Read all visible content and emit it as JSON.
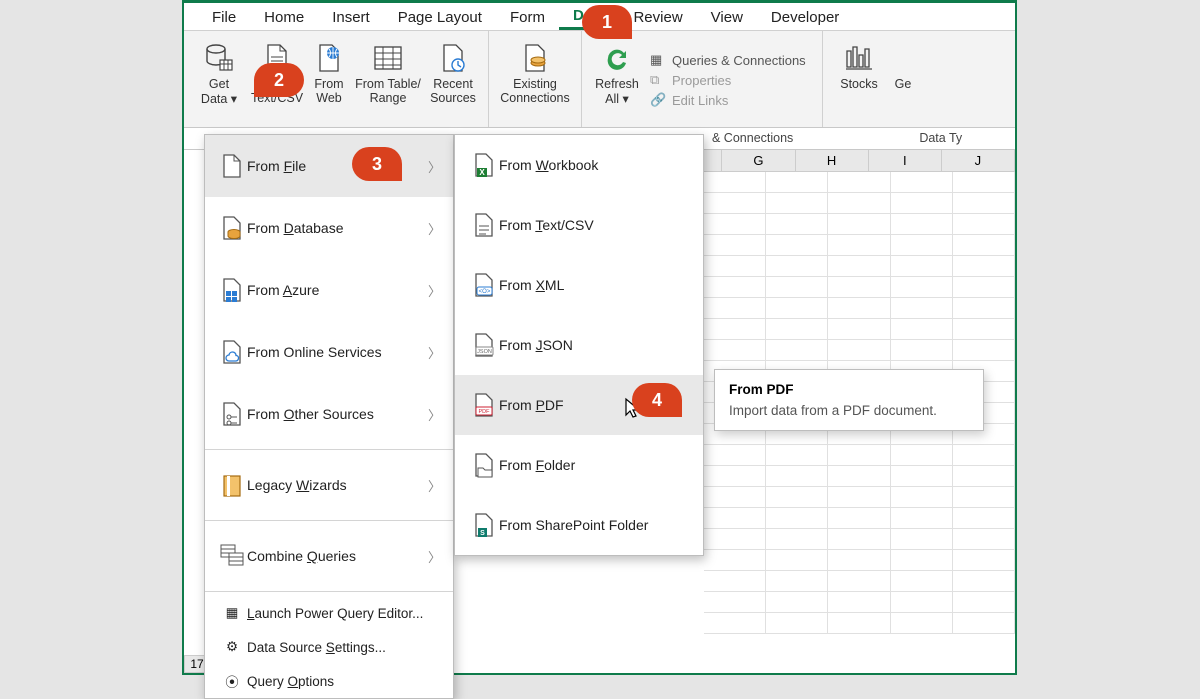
{
  "tabs": [
    "File",
    "Home",
    "Insert",
    "Page Layout",
    "Form",
    "Data",
    "Review",
    "View",
    "Developer"
  ],
  "active_tab": "Data",
  "ribbon": {
    "get_data": {
      "l1": "Get",
      "l2": "Data ▾"
    },
    "text_csv": {
      "l1": "From",
      "l2": "Text/CSV"
    },
    "web": {
      "l1": "From",
      "l2": "Web"
    },
    "table": {
      "l1": "From Table/",
      "l2": "Range"
    },
    "recent": {
      "l1": "Recent",
      "l2": "Sources"
    },
    "existing": {
      "l1": "Existing",
      "l2": "Connections"
    },
    "refresh": {
      "l1": "Refresh",
      "l2": "All ▾"
    },
    "queries": "Queries & Connections",
    "properties": "Properties",
    "editlinks": "Edit Links",
    "stocks": "Stocks",
    "geo": "Ge"
  },
  "section_labels": {
    "qc": "& Connections",
    "dt": "Data Ty"
  },
  "menu1": [
    {
      "label": "From File",
      "sub": true,
      "hover": true,
      "u": "F"
    },
    {
      "label": "From Database",
      "sub": true,
      "u": "D"
    },
    {
      "label": "From Azure",
      "sub": true,
      "u": "A"
    },
    {
      "label": "From Online Services",
      "sub": true
    },
    {
      "label": "From Other Sources",
      "sub": true,
      "u": "O"
    },
    {
      "label": "Legacy Wizards",
      "sub": true,
      "u": "W"
    },
    {
      "label": "Combine Queries",
      "sub": true,
      "u": "Q"
    }
  ],
  "menu1_bottom": [
    {
      "label": "Launch Power Query Editor...",
      "u": "L"
    },
    {
      "label": "Data Source Settings...",
      "u": "S"
    },
    {
      "label": "Query Options",
      "u": "O"
    }
  ],
  "menu2": [
    {
      "label": "From Workbook",
      "u": "W"
    },
    {
      "label": "From Text/CSV",
      "u": "T"
    },
    {
      "label": "From XML",
      "u": "X"
    },
    {
      "label": "From JSON",
      "u": "J"
    },
    {
      "label": "From PDF",
      "hover": true,
      "u": "P"
    },
    {
      "label": "From Folder",
      "u": "F"
    },
    {
      "label": "From SharePoint Folder"
    }
  ],
  "tooltip": {
    "title": "From PDF",
    "body": "Import data from a PDF document."
  },
  "columns": [
    "G",
    "H",
    "I",
    "J"
  ],
  "row_label": "17",
  "callouts": {
    "c1": "1",
    "c2": "2",
    "c3": "3",
    "c4": "4"
  }
}
